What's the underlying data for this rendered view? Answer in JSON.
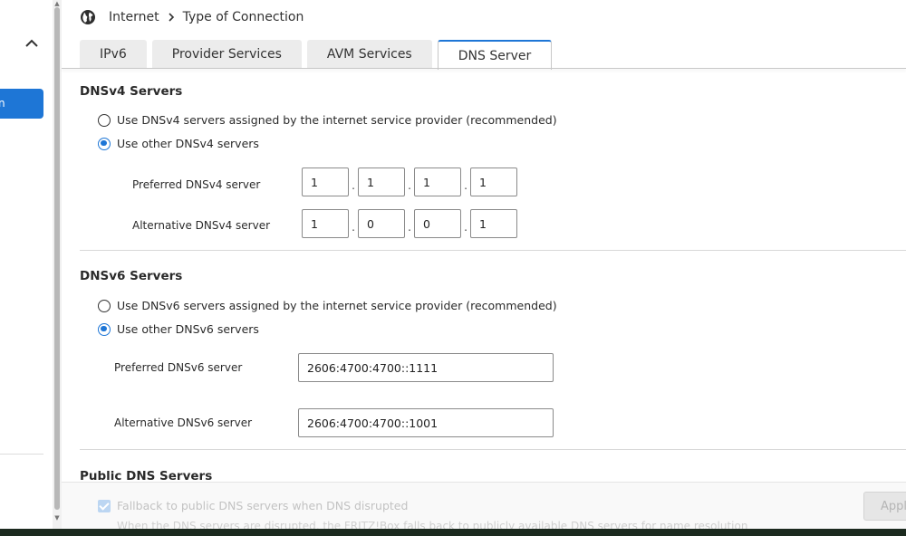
{
  "sidebar": {
    "collapse_icon": "chevron-up-icon",
    "active_item_label": "n"
  },
  "breadcrumb": {
    "icon": "globe-icon",
    "items": [
      "Internet",
      "Type of Connection"
    ]
  },
  "tabs": [
    {
      "label": "IPv6",
      "active": false
    },
    {
      "label": "Provider Services",
      "active": false
    },
    {
      "label": "AVM Services",
      "active": false
    },
    {
      "label": "DNS Server",
      "active": true
    }
  ],
  "dnsv4": {
    "title": "DNSv4 Servers",
    "option_isp": "Use DNSv4 servers assigned by the internet service provider (recommended)",
    "option_other": "Use other DNSv4 servers",
    "selected": "other",
    "preferred_label": "Preferred DNSv4 server",
    "preferred": [
      "1",
      "1",
      "1",
      "1"
    ],
    "alternative_label": "Alternative DNSv4 server",
    "alternative": [
      "1",
      "0",
      "0",
      "1"
    ]
  },
  "dnsv6": {
    "title": "DNSv6 Servers",
    "option_isp": "Use DNSv6 servers assigned by the internet service provider (recommended)",
    "option_other": "Use other DNSv6 servers",
    "selected": "other",
    "preferred_label": "Preferred DNSv6 server",
    "preferred": "2606:4700:4700::1111",
    "alternative_label": "Alternative DNSv6 server",
    "alternative": "2606:4700:4700::1001"
  },
  "public_dns": {
    "title": "Public DNS Servers",
    "fallback_label": "Fallback to public DNS servers when DNS disrupted",
    "fallback_checked": true,
    "fallback_desc": "When the DNS servers are disrupted, the FRITZ!Box falls back to publicly available DNS servers for name resolution"
  },
  "footer": {
    "apply_label": "Apply"
  },
  "colors": {
    "accent": "#1e76d6"
  }
}
